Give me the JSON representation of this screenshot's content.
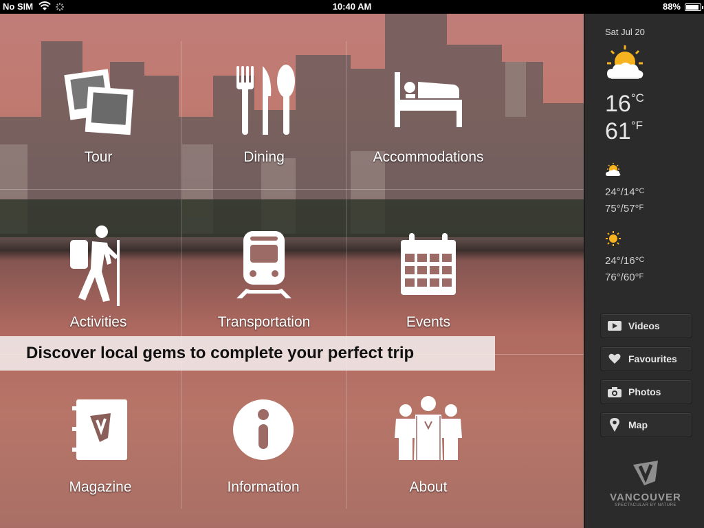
{
  "status_bar": {
    "carrier": "No SIM",
    "time": "10:40 AM",
    "battery": "88%",
    "battery_level": 0.88
  },
  "tiles": [
    {
      "label": "Tour",
      "icon": "photos-icon"
    },
    {
      "label": "Dining",
      "icon": "cutlery-icon"
    },
    {
      "label": "Accommodations",
      "icon": "bed-icon"
    },
    {
      "label": "Activities",
      "icon": "hiker-icon"
    },
    {
      "label": "Transportation",
      "icon": "train-icon"
    },
    {
      "label": "Events",
      "icon": "calendar-icon"
    },
    {
      "label": "Magazine",
      "icon": "magazine-icon"
    },
    {
      "label": "Information",
      "icon": "info-icon"
    },
    {
      "label": "About",
      "icon": "people-icon"
    }
  ],
  "banner": "Discover local gems to complete your perfect trip",
  "weather": {
    "date": "Sat Jul 20",
    "current_c": "16",
    "current_f": "61",
    "unit_c": "°C",
    "unit_f": "°F",
    "forecast": [
      {
        "icon": "partly-cloudy-icon",
        "c": "24°/14°",
        "f": "75°/57°"
      },
      {
        "icon": "sunny-icon",
        "c": "24°/16°",
        "f": "76°/60°"
      }
    ],
    "c_suffix": "C",
    "f_suffix": "F"
  },
  "side_buttons": [
    {
      "label": "Videos",
      "icon": "video-icon"
    },
    {
      "label": "Favourites",
      "icon": "heart-icon"
    },
    {
      "label": "Photos",
      "icon": "camera-icon"
    },
    {
      "label": "Map",
      "icon": "map-pin-icon"
    }
  ],
  "logo": {
    "name": "VANCOUVER",
    "tagline": "SPECTACULAR BY NATURE"
  },
  "colors": {
    "sidebar": "#2b2b2b",
    "banner_bg": "#f5f0f0",
    "water": "#b77568",
    "sky": "#c07c78"
  }
}
